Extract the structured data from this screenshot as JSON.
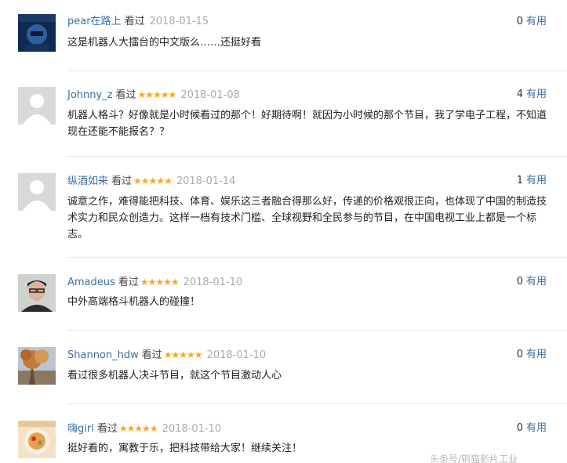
{
  "reviews": [
    {
      "user": "pear在路上",
      "seen": "看过",
      "stars": "",
      "date": "2018-01-15",
      "useful_count": "0",
      "useful_label": "有用",
      "text": "这是机器人大擂台的中文版么……还挺好看",
      "avatar": "dark-blue-photo"
    },
    {
      "user": "Johnny_z",
      "seen": "看过",
      "stars": "★★★★★",
      "date": "2018-01-08",
      "useful_count": "4",
      "useful_label": "有用",
      "text": "机器人格斗？好像就是小时候看过的那个！好期待啊！就因为小时候的那个节目，我了学电子工程，不知道现在还能不能报名？？",
      "avatar": "default-avatar"
    },
    {
      "user": "纵酒如来",
      "seen": "看过",
      "stars": "★★★★★",
      "date": "2018-01-14",
      "useful_count": "1",
      "useful_label": "有用",
      "text": "诚意之作，难得能把科技、体育、娱乐这三者融合得那么好，传递的价格观很正向，也体现了中国的制造技术实力和民众创造力。这样一档有技术门槛、全球视野和全民参与的节目，在中国电视工业上都是一个标志。",
      "avatar": "default-avatar"
    },
    {
      "user": "Amadeus",
      "seen": "看过",
      "stars": "★★★★★",
      "date": "2018-01-10",
      "useful_count": "0",
      "useful_label": "有用",
      "text": "中外高端格斗机器人的碰撞！",
      "avatar": "person-photo"
    },
    {
      "user": "Shannon_hdw",
      "seen": "看过",
      "stars": "★★★★★",
      "date": "2018-01-10",
      "useful_count": "0",
      "useful_label": "有用",
      "text": "看过很多机器人决斗节目，就这个节目激动人心",
      "avatar": "tree-photo"
    },
    {
      "user": "嗨girl",
      "seen": "看过",
      "stars": "★★★★★",
      "date": "2018-01-10",
      "useful_count": "0",
      "useful_label": "有用",
      "text": "挺好看的，寓教于乐，把科技带给大家！继续关注！",
      "avatar": "food-photo"
    }
  ],
  "watermark": "头条号/铜猫影片工业",
  "colors": {
    "username": "#3b6e9e",
    "star": "#f5a623",
    "date": "#aaaaaa",
    "divider": "#e8e8e8"
  }
}
